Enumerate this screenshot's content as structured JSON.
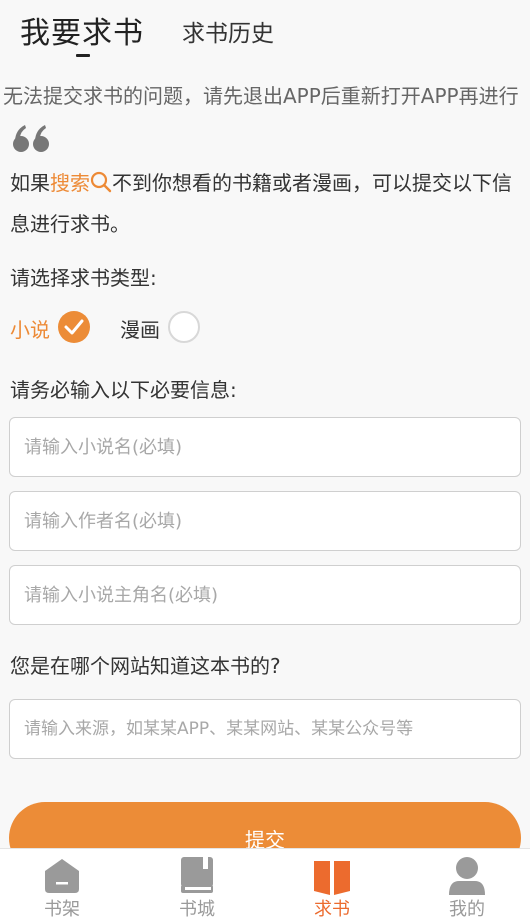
{
  "header": {
    "tab_request": "我要求书",
    "tab_history": "求书历史"
  },
  "notice": {
    "text": "无法提交求书的问题，请先退出APP后重新打开APP再进行"
  },
  "intro": {
    "before": "如果",
    "search_word": "搜索",
    "after": "不到你想看的书籍或者漫画，可以提交以下信息进行求书。"
  },
  "type_section": {
    "label": "请选择求书类型:",
    "options": [
      {
        "label": "小说",
        "selected": true
      },
      {
        "label": "漫画",
        "selected": false
      }
    ]
  },
  "required_section": {
    "label": "请务必输入以下必要信息:",
    "fields": [
      {
        "placeholder": "请输入小说名(必填)",
        "value": ""
      },
      {
        "placeholder": "请输入作者名(必填)",
        "value": ""
      },
      {
        "placeholder": "请输入小说主角名(必填)",
        "value": ""
      }
    ]
  },
  "source_section": {
    "label": "您是在哪个网站知道这本书的?",
    "placeholder": "请输入来源，如某某APP、某某网站、某某公众号等",
    "value": ""
  },
  "submit": {
    "label": "提交"
  },
  "tabbar": {
    "items": [
      {
        "label": "书架",
        "icon": "bookshelf-icon",
        "active": false
      },
      {
        "label": "书城",
        "icon": "book-store-icon",
        "active": false
      },
      {
        "label": "求书",
        "icon": "open-book-icon",
        "active": true
      },
      {
        "label": "我的",
        "icon": "user-icon",
        "active": false
      }
    ]
  },
  "colors": {
    "accent": "#ec8c37",
    "active_tab": "#ec6b2e",
    "inactive_tab": "#9a9a9a",
    "background": "#f8f8f8"
  }
}
